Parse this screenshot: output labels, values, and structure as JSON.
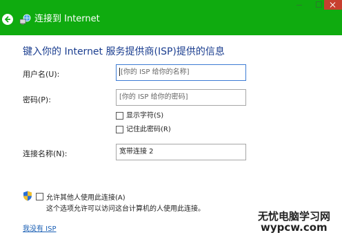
{
  "window": {
    "title": "连接到 Internet",
    "colors": {
      "titlebar": "#0fab0f",
      "heading": "#1a3d8f",
      "link": "#1a5fb4",
      "close": "#c7402f"
    }
  },
  "heading": "键入你的 Internet 服务提供商(ISP)提供的信息",
  "form": {
    "username_label": "用户名(U):",
    "username_placeholder": "[你的 ISP 给你的名称]",
    "password_label": "密码(P):",
    "password_placeholder": "[你的 ISP 给你的密码]",
    "show_chars_label": "显示字符(S)",
    "remember_password_label": "记住此密码(R)",
    "connection_name_label": "连接名称(N):",
    "connection_name_value": "宽带连接 2"
  },
  "allow_others": {
    "label": "允许其他人使用此连接(A)",
    "description": "这个选项允许可以访问这台计算机的人使用此连接。"
  },
  "no_isp_link": "我没有 ISP",
  "watermark": {
    "line1": "无忧电脑学习网",
    "line2": "wypcw.com"
  },
  "icons": [
    "back-arrow-icon",
    "network-icon",
    "shield-icon"
  ]
}
